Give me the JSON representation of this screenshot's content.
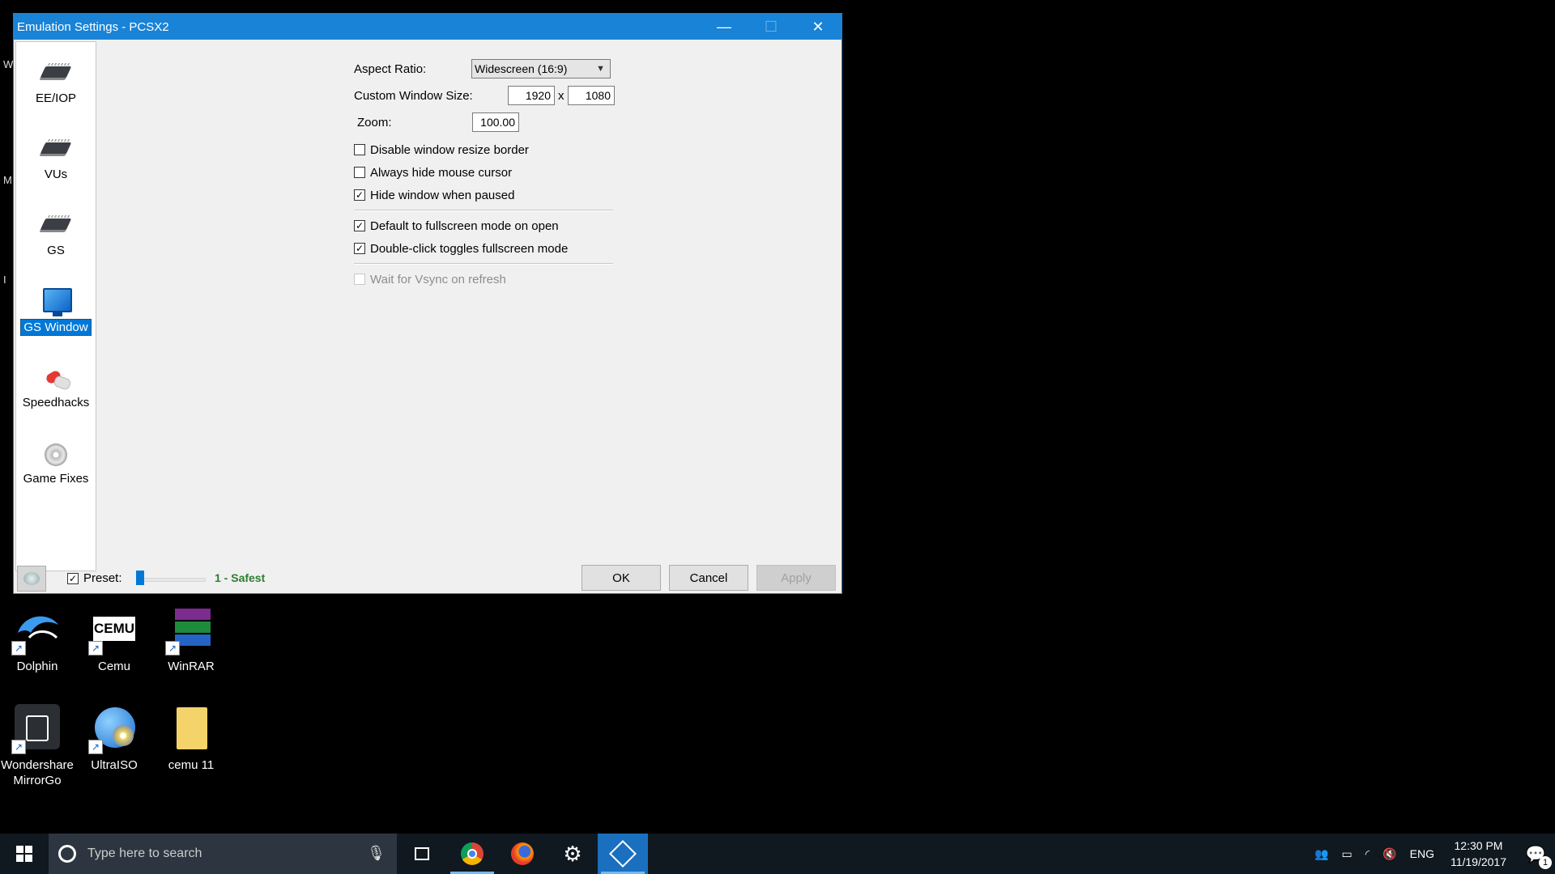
{
  "window": {
    "title": "Emulation Settings - PCSX2",
    "controls": {
      "minimize": "—",
      "maximize": "☐",
      "close": "✕"
    }
  },
  "sidebar": {
    "items": [
      {
        "label": "EE/IOP",
        "icon": "chip-icon"
      },
      {
        "label": "VUs",
        "icon": "chip-icon"
      },
      {
        "label": "GS",
        "icon": "chip-icon"
      },
      {
        "label": "GS Window",
        "icon": "monitor-icon",
        "selected": true
      },
      {
        "label": "Speedhacks",
        "icon": "pills-icon"
      },
      {
        "label": "Game Fixes",
        "icon": "disc-icon"
      }
    ]
  },
  "settings": {
    "aspect_ratio_label": "Aspect Ratio:",
    "aspect_ratio_value": "Widescreen (16:9)",
    "custom_size_label": "Custom Window Size:",
    "width_value": "1920",
    "x_sep": "x",
    "height_value": "1080",
    "zoom_label": "Zoom:",
    "zoom_value": "100.00",
    "checks": [
      {
        "label": "Disable window resize border",
        "checked": false
      },
      {
        "label": "Always hide mouse cursor",
        "checked": false
      },
      {
        "label": "Hide window when paused",
        "checked": true
      },
      {
        "label": "Default to fullscreen mode on open",
        "checked": true
      },
      {
        "label": "Double-click toggles fullscreen mode",
        "checked": true
      },
      {
        "label": "Wait for Vsync on refresh",
        "checked": false,
        "disabled": true
      }
    ]
  },
  "footer": {
    "preset_label": "Preset:",
    "preset_checked": true,
    "preset_level": "1 - Safest",
    "preset_level_color": "#2e7d32",
    "ok": "OK",
    "cancel": "Cancel",
    "apply": "Apply"
  },
  "desktop": {
    "edge_letters": [
      "W",
      "M",
      "I"
    ],
    "icons": [
      {
        "label": "Dolphin",
        "icon": "dolphin-icon"
      },
      {
        "label": "Cemu",
        "icon": "cemu-icon",
        "text": "CEMU"
      },
      {
        "label": "WinRAR",
        "icon": "winrar-icon"
      },
      {
        "label": "Wondershare MirrorGo",
        "icon": "mirrorgo-icon"
      },
      {
        "label": "UltraISO",
        "icon": "ultraiso-icon"
      },
      {
        "label": "cemu 11",
        "icon": "folder-icon"
      }
    ]
  },
  "taskbar": {
    "search_placeholder": "Type here to search",
    "apps": [
      "task-view-icon",
      "chrome-icon",
      "firefox-icon",
      "settings-icon",
      "pcsx2-icon"
    ],
    "tray_lang": "ENG",
    "time": "12:30 PM",
    "date": "11/19/2017",
    "notification_count": "1"
  }
}
